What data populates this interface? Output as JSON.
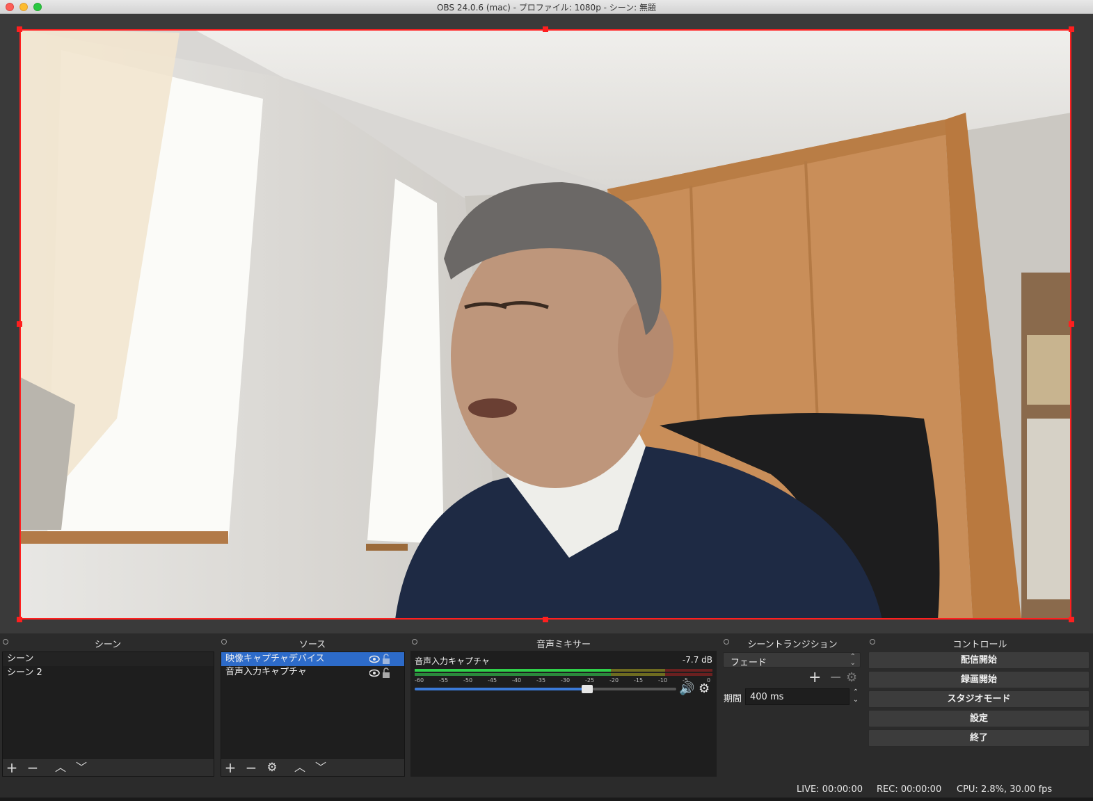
{
  "window": {
    "title": "OBS 24.0.6 (mac) - プロファイル: 1080p - シーン: 無題"
  },
  "colors": {
    "selection": "#ff1f1f",
    "accent": "#2d6bc9",
    "meter_green": "#2fd14a",
    "meter_yellow": "#c9c12a",
    "meter_red": "#c93333"
  },
  "scenes": {
    "title": "シーン",
    "items": [
      "シーン",
      "シーン 2"
    ]
  },
  "sources": {
    "title": "ソース",
    "items": [
      {
        "label": "映像キャプチャデバイス",
        "selected": true
      },
      {
        "label": "音声入力キャプチャ",
        "selected": false
      }
    ]
  },
  "mixer": {
    "title": "音声ミキサー",
    "track_name": "音声入力キャプチャ",
    "level_db": "-7.7 dB",
    "scale": [
      "-60",
      "-55",
      "-50",
      "-45",
      "-40",
      "-35",
      "-30",
      "-25",
      "-20",
      "-15",
      "-10",
      "-5",
      "0"
    ],
    "volume_fraction": 0.66
  },
  "transitions": {
    "title": "シーントランジション",
    "selected": "フェード",
    "duration_label": "期間",
    "duration_value": "400 ms"
  },
  "controls": {
    "title": "コントロール",
    "buttons": [
      "配信開始",
      "録画開始",
      "スタジオモード",
      "設定",
      "終了"
    ]
  },
  "status": {
    "live": "LIVE: 00:00:00",
    "rec": "REC: 00:00:00",
    "cpu": "CPU: 2.8%, 30.00 fps"
  }
}
